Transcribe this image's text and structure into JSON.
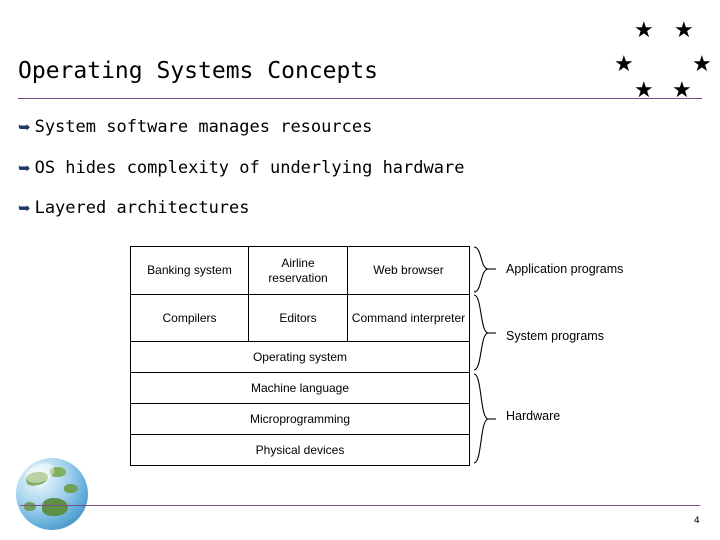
{
  "slide": {
    "title": "Operating Systems Concepts",
    "page_number": "4",
    "bullet_marker": "➥",
    "bullets": [
      {
        "text": "System software manages resources"
      },
      {
        "text": "OS hides complexity of underlying hardware"
      },
      {
        "text": "Layered architectures"
      }
    ],
    "decor": {
      "star_glyph": "★",
      "star_count": 6,
      "globe_name": "globe-image"
    },
    "colors": {
      "rule": "#7b4f8c",
      "bullet_marker": "#1f3864",
      "text": "#000000"
    }
  },
  "diagram": {
    "name": "layered-architecture-diagram",
    "rows": [
      {
        "cells": [
          {
            "label": "Banking system"
          },
          {
            "label": "Airline reservation"
          },
          {
            "label": "Web browser"
          }
        ]
      },
      {
        "cells": [
          {
            "label": "Compilers"
          },
          {
            "label": "Editors"
          },
          {
            "label": "Command interpreter"
          }
        ]
      },
      {
        "cells": [
          {
            "label": "Operating system"
          }
        ]
      },
      {
        "cells": [
          {
            "label": "Machine language"
          }
        ]
      },
      {
        "cells": [
          {
            "label": "Microprogramming"
          }
        ]
      },
      {
        "cells": [
          {
            "label": "Physical devices"
          }
        ]
      }
    ],
    "group_labels": [
      {
        "label": "Application programs"
      },
      {
        "label": "System programs"
      },
      {
        "label": "Hardware"
      }
    ]
  }
}
